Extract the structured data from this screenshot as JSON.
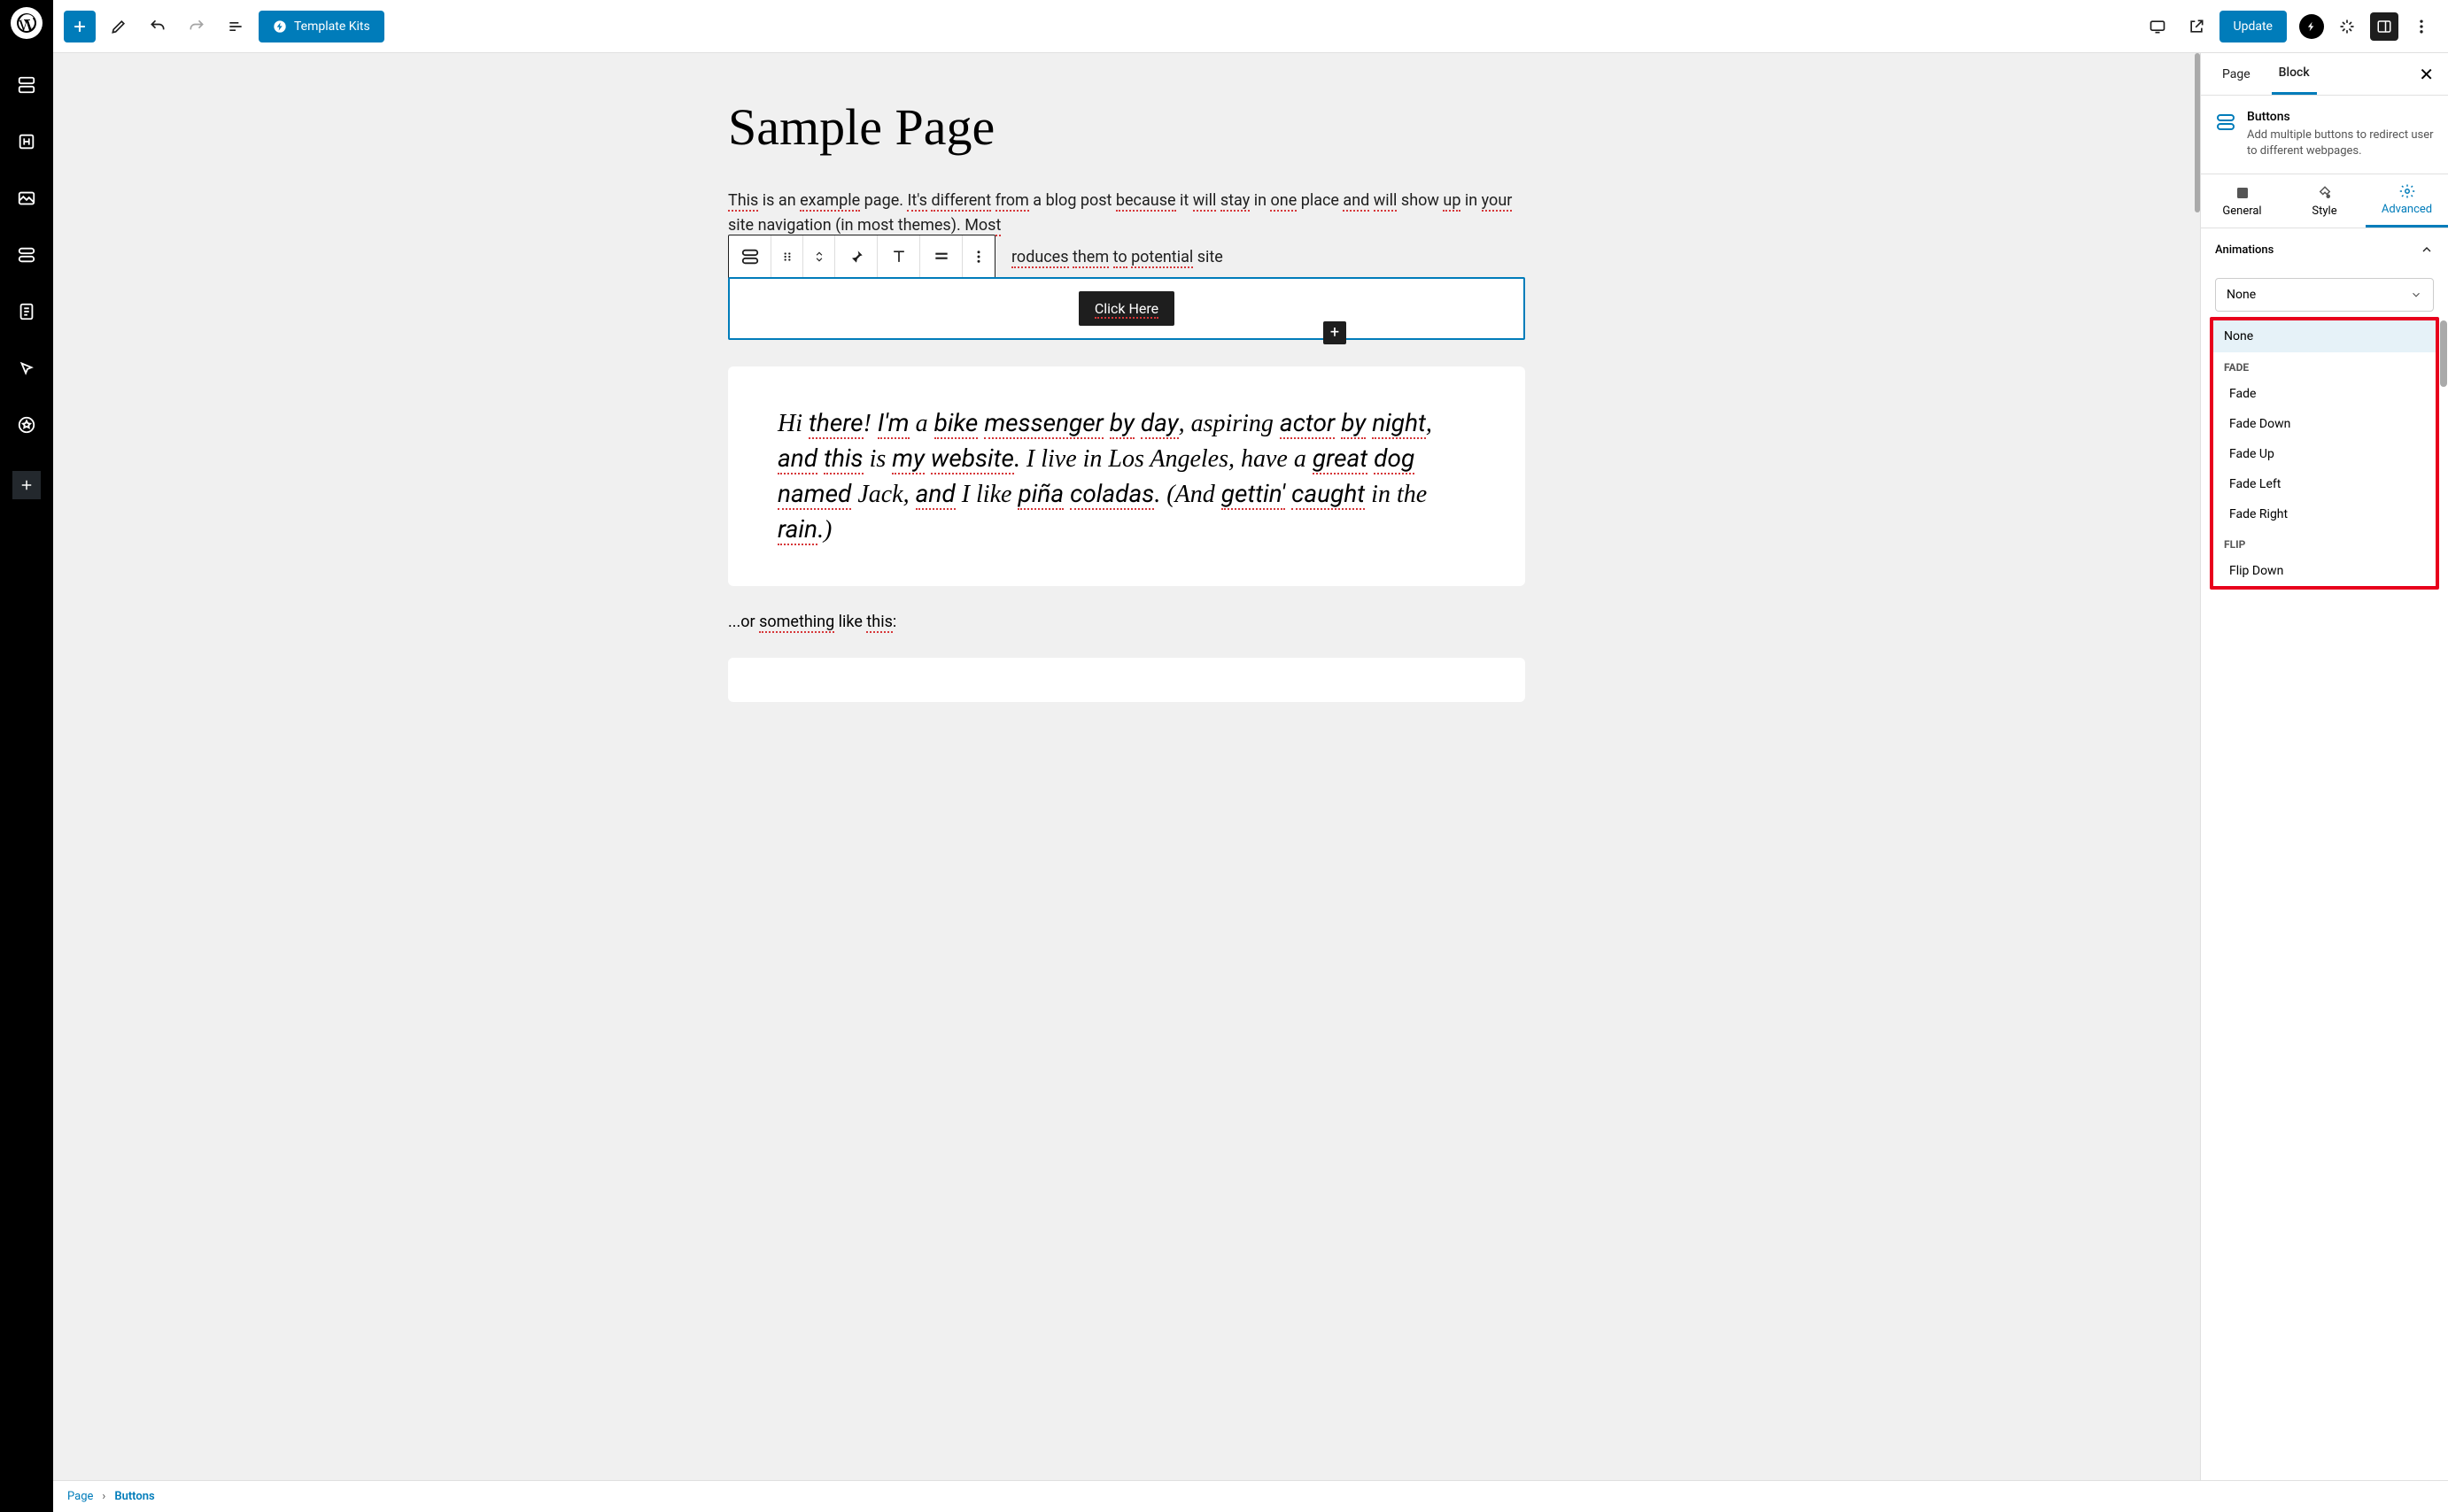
{
  "topbar": {
    "template_kits": "Template Kits",
    "update": "Update"
  },
  "page": {
    "title": "Sample Page",
    "paragraph": "This is an example page. It's different from a blog post because it will stay in one place and will show up in your site navigation (in most themes). Most",
    "paragraph_trail": "roduces them to potential site",
    "button_label": "Click Here",
    "quote": "Hi there! I'm a bike messenger by day, aspiring actor by night, and this is my website. I live in Los Angeles, have a great dog named Jack, and I like piña coladas. (And gettin' caught in the rain.)",
    "trailing": "...or something like this:"
  },
  "sidebar": {
    "tabs": {
      "page": "Page",
      "block": "Block"
    },
    "block_header": {
      "title": "Buttons",
      "desc": "Add multiple buttons to redirect user to different webpages."
    },
    "subtabs": {
      "general": "General",
      "style": "Style",
      "advanced": "Advanced"
    },
    "section": {
      "animations": "Animations"
    },
    "select_value": "None",
    "dropdown": {
      "none": "None",
      "group_fade": "FADE",
      "fade": "Fade",
      "fade_down": "Fade Down",
      "fade_up": "Fade Up",
      "fade_left": "Fade Left",
      "fade_right": "Fade Right",
      "group_flip": "FLIP",
      "flip_down": "Flip Down"
    }
  },
  "breadcrumb": {
    "page": "Page",
    "buttons": "Buttons"
  }
}
